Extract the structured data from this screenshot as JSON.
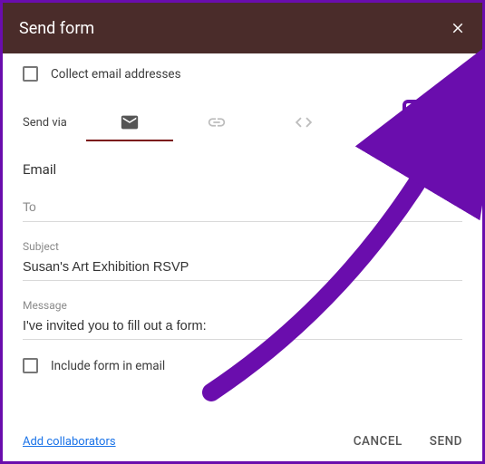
{
  "header": {
    "title": "Send form"
  },
  "collect": {
    "label": "Collect email addresses"
  },
  "sendvia": {
    "label": "Send via"
  },
  "section": {
    "title": "Email"
  },
  "to": {
    "placeholder": "To",
    "value": ""
  },
  "subject": {
    "label": "Subject",
    "value": "Susan's Art Exhibition RSVP"
  },
  "message": {
    "label": "Message",
    "value": "I've invited you to fill out a form:"
  },
  "include": {
    "label": "Include form in email"
  },
  "footer": {
    "collab": "Add collaborators",
    "cancel": "CANCEL",
    "send": "SEND"
  }
}
